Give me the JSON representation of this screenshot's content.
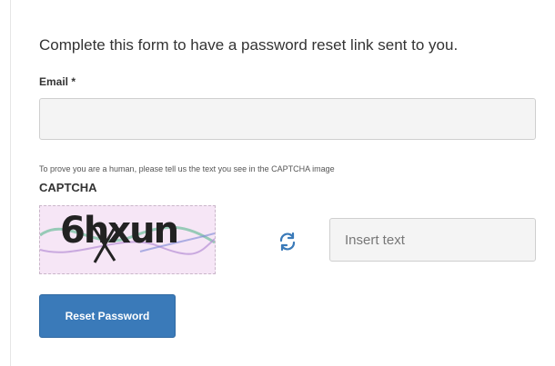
{
  "form": {
    "intro": "Complete this form to have a password reset link sent to you.",
    "email_label": "Email *",
    "email_value": "",
    "helper_text": "To prove you are a human, please tell us the text you see in the CAPTCHA image",
    "captcha_label": "CAPTCHA",
    "captcha_image_text": "6hxun",
    "captcha_refresh_icon": "refresh-icon",
    "captcha_placeholder": "Insert text",
    "captcha_value": "",
    "submit_label": "Reset Password"
  },
  "colors": {
    "primary_button": "#3a7ab9",
    "refresh_icon": "#3a7ab9",
    "input_background": "#f4f4f4",
    "captcha_background": "#f6e6f6"
  }
}
